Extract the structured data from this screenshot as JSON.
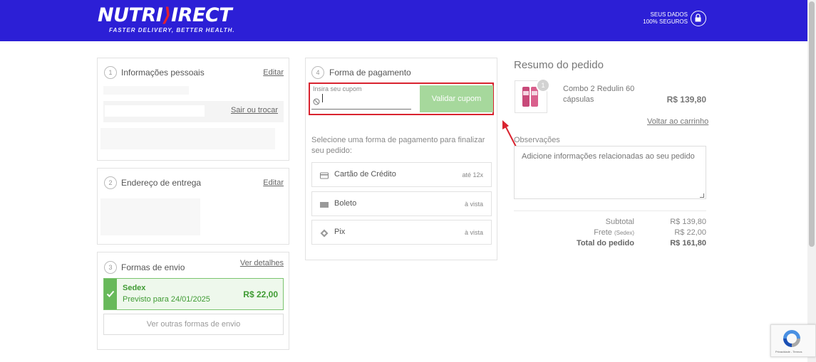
{
  "header": {
    "logo_main": "NUTRI",
    "logo_x": "⟩",
    "logo_rest": "IRECT",
    "tagline": "FASTER DELIVERY, BETTER HEALTH.",
    "secure_line1": "SEUS DADOS",
    "secure_line2": "100% SEGUROS",
    "secure_icon": "lock-icon"
  },
  "personal": {
    "step": "1",
    "title": "Informações pessoais",
    "edit_label": "Editar",
    "logout_label": "Sair ou trocar"
  },
  "address": {
    "step": "2",
    "title": "Endereço de entrega",
    "edit_label": "Editar"
  },
  "shipping": {
    "step": "3",
    "title": "Formas de envio",
    "details_label": "Ver detalhes",
    "selected": {
      "name": "Sedex",
      "eta": "Previsto para 24/01/2025",
      "price": "R$ 22,00"
    },
    "other_label": "Ver outras formas de envio"
  },
  "payment": {
    "step": "4",
    "title": "Forma de pagamento",
    "coupon_label": "Insira seu cupom",
    "coupon_value": "",
    "coupon_button": "Validar cupom",
    "intro": "Selecione uma forma de pagamento para finalizar seu pedido:",
    "options": [
      {
        "name": "Cartão de Crédito",
        "term": "até 12x",
        "icon": "credit-card-icon"
      },
      {
        "name": "Boleto",
        "term": "à vista",
        "icon": "barcode-icon"
      },
      {
        "name": "Pix",
        "term": "à vista",
        "icon": "pix-icon"
      }
    ]
  },
  "summary": {
    "title": "Resumo do pedido",
    "product": {
      "qty": "1",
      "name": "Combo 2 Redulin 60 cápsulas",
      "price": "R$ 139,80"
    },
    "back_to_cart": "Voltar ao carrinho",
    "notes_label": "Observações",
    "notes_placeholder": "Adicione informações relacionadas ao seu pedido",
    "subtotal_label": "Subtotal",
    "subtotal_value": "R$ 139,80",
    "shipping_label": "Frete",
    "shipping_method": "(Sedex)",
    "shipping_value": "R$ 22,00",
    "total_label": "Total do pedido",
    "total_value": "R$ 161,80"
  },
  "recaptcha": {
    "text": "Privacidade - Termos"
  },
  "colors": {
    "header_bg": "#2c1fd6",
    "logo_accent": "#e3202f",
    "selected_green": "#67b95a",
    "highlight_red": "#d9232f"
  }
}
